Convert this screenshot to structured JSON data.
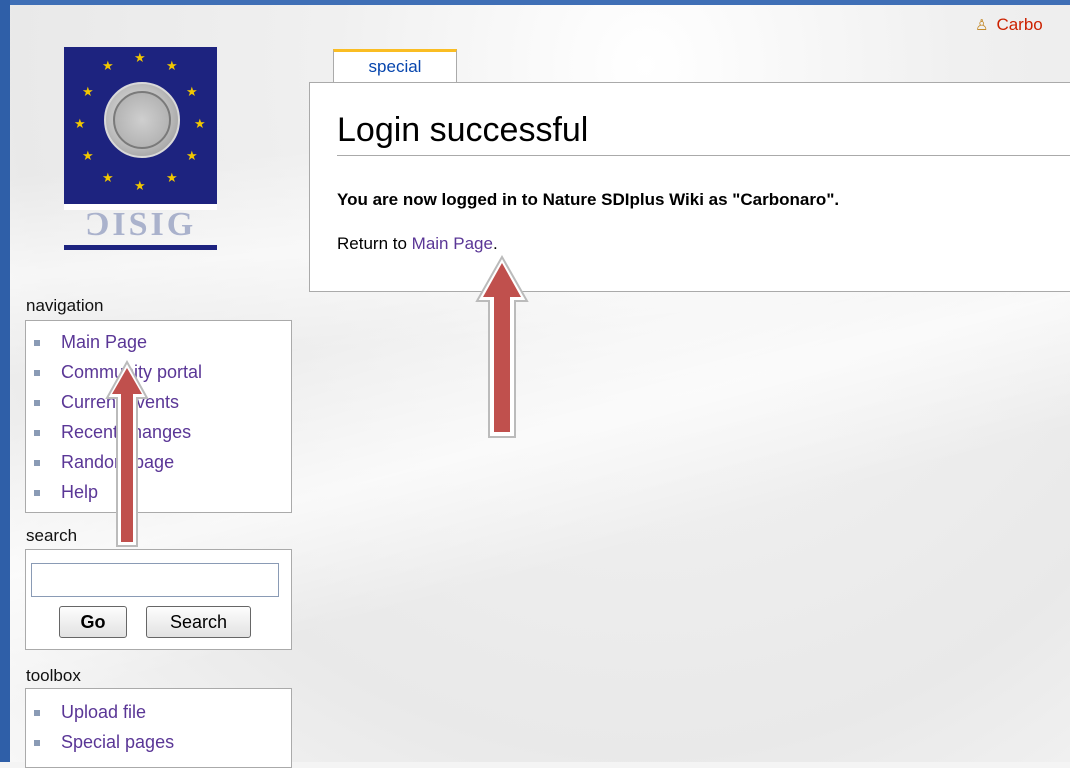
{
  "user": {
    "name": "Carbo",
    "icon": "user-icon"
  },
  "tab": {
    "label": "special"
  },
  "content": {
    "title": "Login successful",
    "message": "You are now logged in to Nature SDIplus Wiki as \"Carbonaro\".",
    "return_prefix": "Return to ",
    "return_link": "Main Page",
    "return_suffix": "."
  },
  "logo": {
    "wordmark": "ƆISIG",
    "alt": "site-logo"
  },
  "navigation": {
    "title": "navigation",
    "items": [
      "Main Page",
      "Community portal",
      "Current events",
      "Recent changes",
      "Random page",
      "Help"
    ]
  },
  "search": {
    "title": "search",
    "value": "",
    "go_label": "Go",
    "search_label": "Search"
  },
  "toolbox": {
    "title": "toolbox",
    "items": [
      "Upload file",
      "Special pages"
    ]
  },
  "colors": {
    "link": "#5a3696",
    "tab_link": "#0645ad",
    "user_link": "#cc2200",
    "arrow": "#c0504d",
    "frame": "#2f5fa8"
  }
}
